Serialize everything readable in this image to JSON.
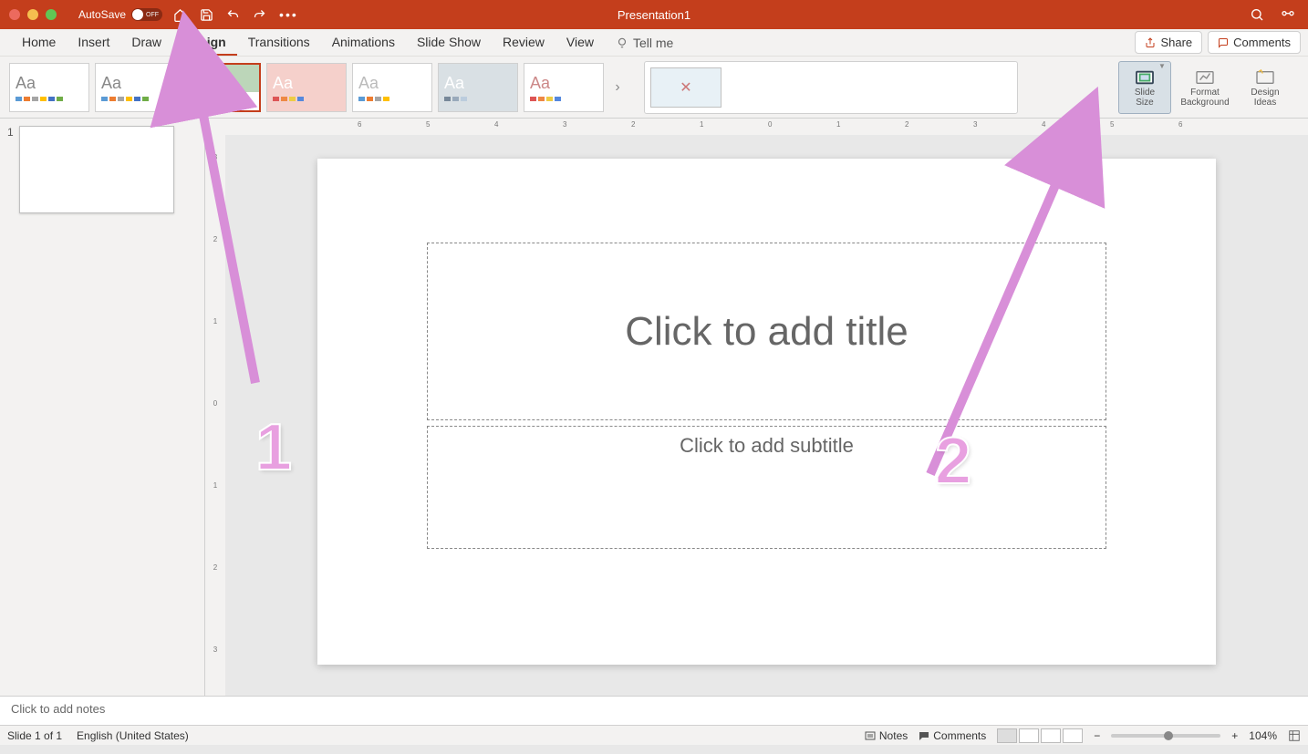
{
  "titlebar": {
    "autosave_label": "AutoSave",
    "autosave_state": "OFF",
    "doc_title": "Presentation1"
  },
  "tabs": {
    "home": "Home",
    "insert": "Insert",
    "draw": "Draw",
    "design": "Design",
    "transitions": "Transitions",
    "animations": "Animations",
    "slideshow": "Slide Show",
    "review": "Review",
    "view": "View",
    "tellme": "Tell me"
  },
  "top_right": {
    "share": "Share",
    "comments": "Comments"
  },
  "ribbon": {
    "theme_label": "Aa",
    "slide_size": "Slide\nSize",
    "format_bg": "Format\nBackground",
    "design_ideas": "Design\nIdeas"
  },
  "slide": {
    "title_placeholder": "Click to add title",
    "subtitle_placeholder": "Click to add subtitle"
  },
  "thumb": {
    "number": "1"
  },
  "notes": {
    "placeholder": "Click to add notes"
  },
  "status": {
    "slide_count": "Slide 1 of 1",
    "language": "English (United States)",
    "notes_btn": "Notes",
    "comments_btn": "Comments",
    "zoom": "104%"
  },
  "ruler": {
    "h": [
      "6",
      "5",
      "4",
      "3",
      "2",
      "1",
      "0",
      "1",
      "2",
      "3",
      "4",
      "5",
      "6"
    ],
    "v": [
      "3",
      "2",
      "1",
      "0",
      "1",
      "2",
      "3"
    ]
  },
  "annotations": {
    "one": "1",
    "two": "2"
  }
}
